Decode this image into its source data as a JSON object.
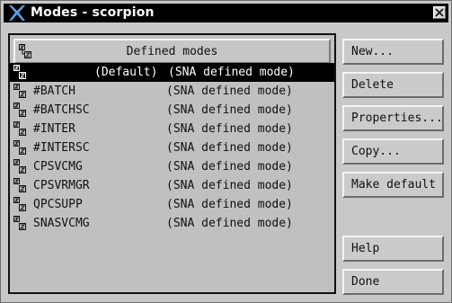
{
  "window": {
    "title": "Modes - scorpion",
    "close_icon": "close-x-icon",
    "app_icon": "x-logo-icon"
  },
  "list": {
    "header_label": "Defined modes",
    "header_icon": "mode-icon",
    "rows": [
      {
        "name": "(Default)",
        "desc": "(SNA defined mode)",
        "selected": true
      },
      {
        "name": "#BATCH",
        "desc": "(SNA defined mode)",
        "selected": false
      },
      {
        "name": "#BATCHSC",
        "desc": "(SNA defined mode)",
        "selected": false
      },
      {
        "name": "#INTER",
        "desc": "(SNA defined mode)",
        "selected": false
      },
      {
        "name": "#INTERSC",
        "desc": "(SNA defined mode)",
        "selected": false
      },
      {
        "name": "CPSVCMG",
        "desc": "(SNA defined mode)",
        "selected": false
      },
      {
        "name": "CPSVRMGR",
        "desc": "(SNA defined mode)",
        "selected": false
      },
      {
        "name": "QPCSUPP",
        "desc": "(SNA defined mode)",
        "selected": false
      },
      {
        "name": "SNASVCMG",
        "desc": "(SNA defined mode)",
        "selected": false
      }
    ]
  },
  "buttons": {
    "new": "New...",
    "delete": "Delete",
    "properties": "Properties...",
    "copy": "Copy...",
    "make_default": "Make default",
    "help": "Help",
    "done": "Done"
  }
}
